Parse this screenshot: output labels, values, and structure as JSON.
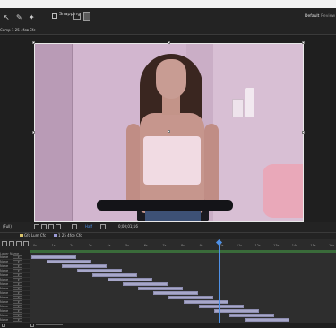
{
  "toolbar": {
    "snapping_label": "Snapping",
    "workspace_active": "Default",
    "workspace_more": "Review"
  },
  "comp_tab": {
    "label": "Comp 1 25 4fce Cfc",
    "close": "×"
  },
  "viewer": {
    "zoom": "(Full)",
    "resolution": "Half",
    "timecode": "0;00;01;16"
  },
  "timeline": {
    "tabs": [
      {
        "label": "Gfc Lum Cfc",
        "color": "#d9c36b"
      },
      {
        "label": "1 25 4fce Cfc",
        "color": "#9c9cd6"
      }
    ],
    "layer_header": "Layer Name",
    "mode_value": "None",
    "ruler_labels": [
      "0s",
      "1s",
      "2s",
      "3s",
      "4s",
      "5s",
      "6s",
      "7s",
      "8s",
      "9s",
      "10s",
      "11s",
      "12s",
      "13s",
      "14s",
      "15s",
      "16s"
    ],
    "track_count": 15,
    "accent": "#4f91e6",
    "bar_color": "#a7a7c9"
  }
}
